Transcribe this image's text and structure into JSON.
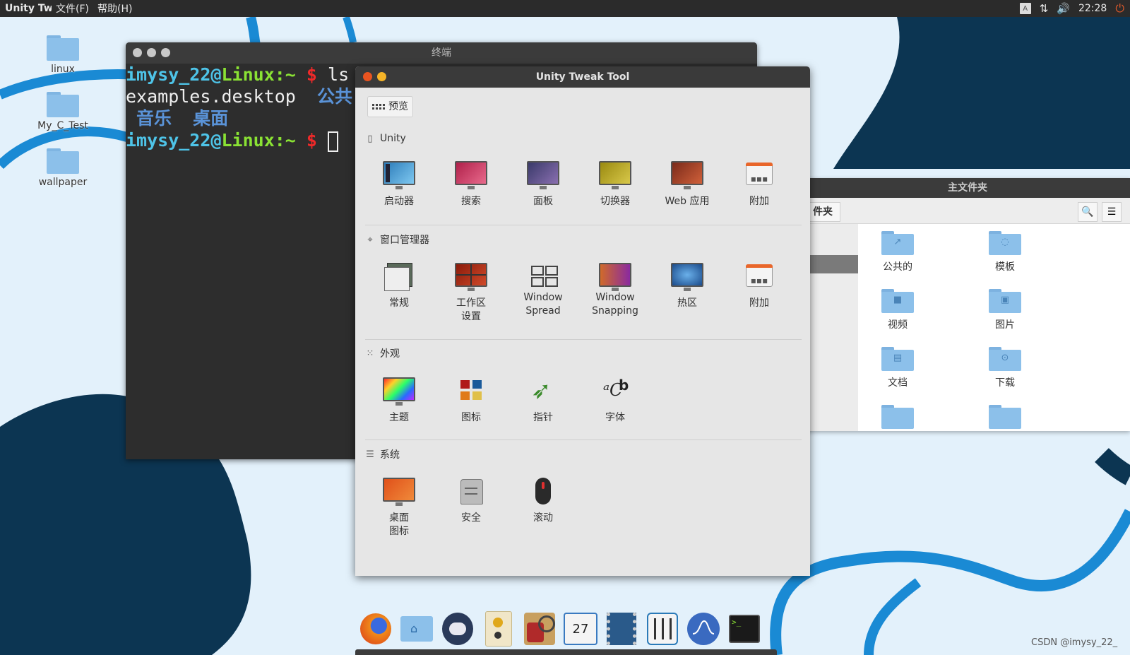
{
  "top_panel": {
    "app_title": "Unity Tw",
    "menus": [
      "文件(F)",
      "帮助(H)"
    ],
    "keyboard_indicator": "A",
    "clock": "22:28"
  },
  "desktop": {
    "icons": [
      {
        "label": "linux"
      },
      {
        "label": "My_C_Test"
      },
      {
        "label": "wallpaper"
      }
    ]
  },
  "terminal": {
    "title": "终端",
    "prompt_user": "imysy_22",
    "prompt_at": "@",
    "prompt_host": "Linux",
    "prompt_path": ":~",
    "prompt_dollar": "$",
    "line1_command": "ls",
    "line2_text": "examples.desktop",
    "line2_dir": "公共",
    "line3_dirs": " 音乐  桌面"
  },
  "files": {
    "title": "主文件夹",
    "path_button": "件夹",
    "items": [
      {
        "label": "公共的",
        "glyph": "↗"
      },
      {
        "label": "模板",
        "glyph": "◌"
      },
      {
        "label": "视频",
        "glyph": "■"
      },
      {
        "label": "图片",
        "glyph": "▣"
      },
      {
        "label": "文档",
        "glyph": "▤"
      },
      {
        "label": "下载",
        "glyph": "⊙"
      }
    ]
  },
  "tweak_tool": {
    "title": "Unity Tweak Tool",
    "overview_label": "预览",
    "sections": [
      {
        "title": "Unity",
        "items": [
          {
            "label": "启动器"
          },
          {
            "label": "搜索"
          },
          {
            "label": "面板"
          },
          {
            "label": "切换器"
          },
          {
            "label": "Web 应用"
          },
          {
            "label": "附加"
          }
        ]
      },
      {
        "title": "窗口管理器",
        "items": [
          {
            "label": "常规"
          },
          {
            "label": "工作区\n设置"
          },
          {
            "label": "Window\nSpread"
          },
          {
            "label": "Window\nSnapping"
          },
          {
            "label": "热区"
          },
          {
            "label": "附加"
          }
        ]
      },
      {
        "title": "外观",
        "items": [
          {
            "label": "主题"
          },
          {
            "label": "图标"
          },
          {
            "label": "指针"
          },
          {
            "label": "字体"
          }
        ]
      },
      {
        "title": "系统",
        "items": [
          {
            "label": "桌面\n图标"
          },
          {
            "label": "安全"
          },
          {
            "label": "滚动"
          }
        ]
      }
    ]
  },
  "dock": {
    "calendar_day": "27"
  },
  "watermark": "CSDN @imysy_22_",
  "colors": {
    "wallpaper_bg": "#e3f1fb",
    "wallpaper_dark": "#0c3552",
    "wallpaper_line": "#1a8ad4",
    "ubuntu_orange": "#e95420"
  }
}
